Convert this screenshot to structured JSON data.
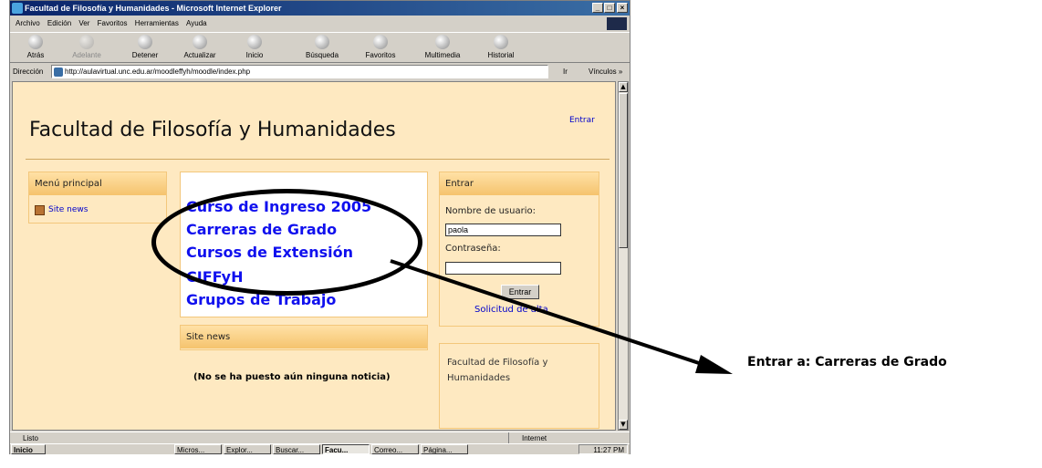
{
  "window": {
    "title": "Facultad de Filosofía y Humanidades - Microsoft Internet Explorer",
    "minimize": "_",
    "maximize": "□",
    "close": "×"
  },
  "menubar": [
    "Archivo",
    "Edición",
    "Ver",
    "Favoritos",
    "Herramientas",
    "Ayuda"
  ],
  "toolbar": [
    {
      "label": "Atrás",
      "icon": "back-arrow-icon",
      "enabled": true
    },
    {
      "label": "Adelante",
      "icon": "forward-arrow-icon",
      "enabled": false
    },
    {
      "label": "Detener",
      "icon": "stop-icon",
      "enabled": true
    },
    {
      "label": "Actualizar",
      "icon": "refresh-icon",
      "enabled": true
    },
    {
      "label": "Inicio",
      "icon": "home-icon",
      "enabled": true
    },
    {
      "label": "Búsqueda",
      "icon": "search-icon",
      "enabled": true
    },
    {
      "label": "Favoritos",
      "icon": "favorites-icon",
      "enabled": true
    },
    {
      "label": "Multimedia",
      "icon": "multimedia-icon",
      "enabled": true
    },
    {
      "label": "Historial",
      "icon": "history-icon",
      "enabled": true
    }
  ],
  "address": {
    "label": "Dirección",
    "url": "http://aulavirtual.unc.edu.ar/moodleffyh/moodle/index.php",
    "go_label": "Ir",
    "links_label": "Vínculos »"
  },
  "page": {
    "site_title": "Facultad de Filosofía y Humanidades",
    "login_link": "Entrar",
    "main_menu": {
      "header": "Menú principal",
      "items": [
        "Site news"
      ]
    },
    "courses": [
      "Curso de Ingreso 2005",
      "Carreras de Grado",
      "Cursos de Extensión",
      "CIFFyH",
      "Grupos de Trabajo"
    ],
    "news": {
      "header": "Site news",
      "empty_text": "(No se ha puesto aún ninguna noticia)"
    },
    "login_block": {
      "header": "Entrar",
      "username_label": "Nombre de usuario:",
      "username_value": "paola",
      "password_label": "Contraseña:",
      "password_value": "",
      "submit_label": "Entrar",
      "signup_link": "Solicitud de alta"
    },
    "about_block": {
      "text": "Facultad de Filosofía y Humanidades"
    }
  },
  "statusbar": {
    "text": "Listo",
    "zone": "Internet"
  },
  "taskbar": {
    "start_label": "Inicio",
    "tasks": [
      "Micros...",
      "Explor...",
      "Buscar...",
      "Facu...",
      "Correo...",
      "Página..."
    ],
    "active_task": "Facu...",
    "clock": "11:27 PM"
  },
  "annotation": {
    "text": "Entrar a: Carreras de Grado"
  },
  "colors": {
    "page_background": "#fee9c1",
    "block_header": "#f5c36d",
    "link": "#1010ee",
    "titlebar": "#0a246a"
  }
}
